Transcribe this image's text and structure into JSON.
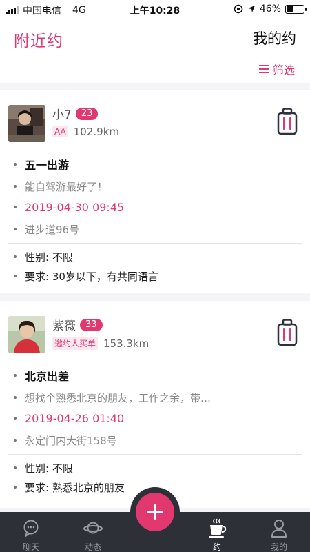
{
  "status_bar": {
    "carrier": "中国电信",
    "network": "4G",
    "time": "上午10:28",
    "battery": "46%",
    "battery_level": 0.46
  },
  "header": {
    "title": "附近约",
    "my_label": "我的约",
    "filter_label": "筛选"
  },
  "cards": [
    {
      "name": "小7",
      "age": "23",
      "tag": "AA",
      "distance": "102.9km",
      "event_title": "五一出游",
      "description": "能自驾游最好了！",
      "datetime": "2019-04-30 09:45",
      "location": "进步道96号",
      "gender": "性别: 不限",
      "requirement": "要求: 30岁以下，有共同语言"
    },
    {
      "name": "紫薇",
      "age": "33",
      "tag": "邀约人买单",
      "distance": "153.3km",
      "event_title": "北京出差",
      "description": "想找个熟悉北京的朋友，工作之余，带…",
      "datetime": "2019-04-26 01:40",
      "location": "永定门内大街158号",
      "gender": "性别: 不限",
      "requirement": "要求: 熟悉北京的朋友"
    }
  ],
  "tabbar": {
    "items": [
      {
        "label": "聊天",
        "icon": "chat-icon"
      },
      {
        "label": "动态",
        "icon": "planet-icon"
      },
      {
        "label": "约",
        "icon": "coffee-icon",
        "active": true
      },
      {
        "label": "我的",
        "icon": "person-icon"
      }
    ],
    "fab_icon": "plus-icon"
  },
  "colors": {
    "accent": "#e0386f",
    "tabbar_bg": "#2d3036",
    "luggage": "#2d3140"
  }
}
